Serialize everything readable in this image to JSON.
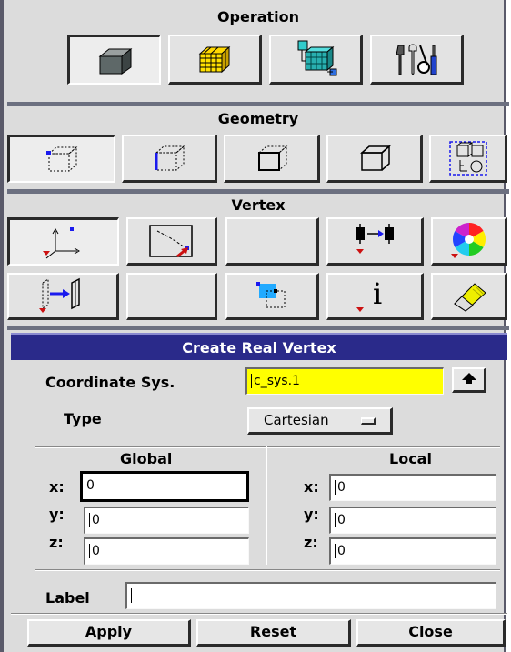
{
  "operation": {
    "title": "Operation",
    "buttons": [
      {
        "icon": "geometry-cube-icon",
        "active": true
      },
      {
        "icon": "mesh-grid-icon",
        "active": false
      },
      {
        "icon": "zones-icon",
        "active": false
      },
      {
        "icon": "tools-icon",
        "active": false
      }
    ]
  },
  "geometry": {
    "title": "Geometry",
    "buttons": [
      {
        "icon": "vertex-cube-icon",
        "active": true
      },
      {
        "icon": "edge-cube-icon",
        "active": false
      },
      {
        "icon": "face-cube-icon",
        "active": false
      },
      {
        "icon": "volume-cube-icon",
        "active": false
      },
      {
        "icon": "group-icon",
        "active": false
      }
    ]
  },
  "vertex": {
    "title": "Vertex",
    "buttons": [
      {
        "icon": "create-vertex-icon",
        "active": true
      },
      {
        "icon": "vertex-on-edge-icon",
        "active": false
      },
      {
        "icon": "blank-icon",
        "active": false
      },
      {
        "icon": "move-vertex-icon",
        "active": false
      },
      {
        "icon": "color-wheel-icon",
        "active": false
      },
      {
        "icon": "project-vertex-icon",
        "active": false
      },
      {
        "icon": "blank-icon",
        "active": false
      },
      {
        "icon": "connect-vertex-icon",
        "active": false
      },
      {
        "icon": "info-icon",
        "active": false
      },
      {
        "icon": "eraser-icon",
        "active": false
      }
    ]
  },
  "form": {
    "title": "Create Real Vertex",
    "coord_label": "Coordinate Sys.",
    "coord_value": "c_sys.1",
    "type_label": "Type",
    "type_value": "Cartesian",
    "global_label": "Global",
    "local_label": "Local",
    "global": {
      "x_label": "x:",
      "y_label": "y:",
      "z_label": "z:",
      "x": "0",
      "y": "0",
      "z": "0"
    },
    "local": {
      "x_label": "x:",
      "y_label": "y:",
      "z_label": "z:",
      "x": "0",
      "y": "0",
      "z": "0"
    },
    "label_label": "Label",
    "label_value": "",
    "apply": "Apply",
    "reset": "Reset",
    "close": "Close"
  },
  "colors": {
    "form_header": "#2a2a8a",
    "highlight_field": "#ffff00",
    "panel": "#dcdcdc"
  }
}
